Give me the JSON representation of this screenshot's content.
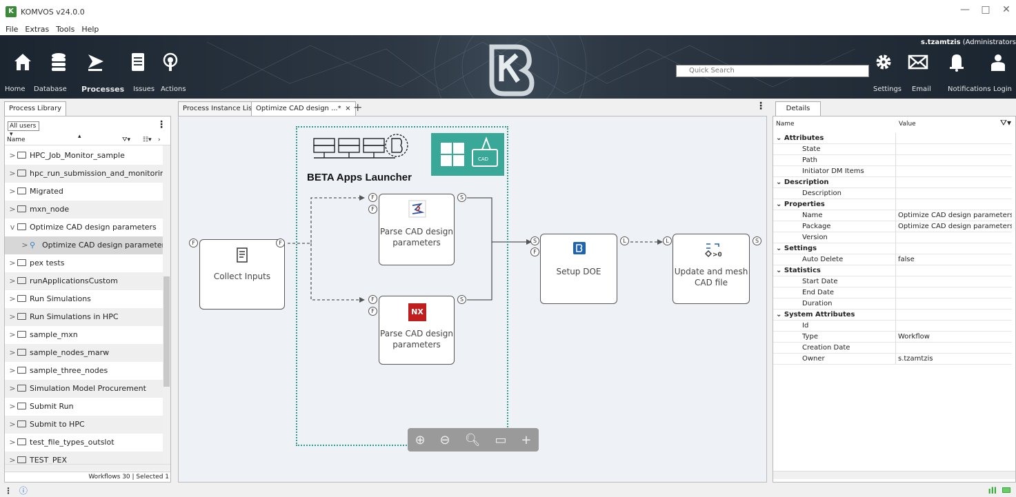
{
  "window": {
    "title": "KOMVOS v24.0.0",
    "minimize": "—",
    "maximize": "□",
    "close": "✕"
  },
  "menu": [
    "File",
    "Extras",
    "Tools",
    "Help"
  ],
  "toolbar": {
    "buttons": [
      {
        "label": "Home",
        "icon": "home-icon"
      },
      {
        "label": "Database",
        "icon": "database-icon"
      },
      {
        "label": "Processes",
        "icon": "processes-icon",
        "active": true
      },
      {
        "label": "Issues",
        "icon": "issues-icon"
      },
      {
        "label": "Actions",
        "icon": "actions-icon"
      }
    ],
    "right_buttons": [
      {
        "label": "Settings",
        "icon": "gear-icon"
      },
      {
        "label": "Email",
        "icon": "email-icon"
      },
      {
        "label": "Notifications",
        "icon": "bell-icon"
      },
      {
        "label": "Login",
        "icon": "user-icon"
      }
    ],
    "search_placeholder": "Quick Search",
    "user_name": "s.tzamtzis",
    "user_role": "(Administrators"
  },
  "library": {
    "tab": "Process Library",
    "filter": "All users",
    "column": "Name",
    "items": [
      {
        "label": "HPC_Job_Monitor_sample",
        "chev": ">",
        "type": "folder"
      },
      {
        "label": "hpc_run_submission_and_monitoring",
        "chev": ">",
        "type": "folder"
      },
      {
        "label": "Migrated",
        "chev": ">",
        "type": "folder"
      },
      {
        "label": "mxn_node",
        "chev": ">",
        "type": "folder"
      },
      {
        "label": "Optimize CAD design parameters",
        "chev": "v",
        "type": "folder"
      },
      {
        "label": "Optimize CAD design parameters",
        "chev": ">",
        "type": "workflow",
        "indent": true,
        "selected": true
      },
      {
        "label": "pex tests",
        "chev": ">",
        "type": "folder"
      },
      {
        "label": "runApplicationsCustom",
        "chev": ">",
        "type": "folder"
      },
      {
        "label": "Run Simulations",
        "chev": ">",
        "type": "folder"
      },
      {
        "label": "Run Simulations in HPC",
        "chev": ">",
        "type": "folder"
      },
      {
        "label": "sample_mxn",
        "chev": ">",
        "type": "folder"
      },
      {
        "label": "sample_nodes_marw",
        "chev": ">",
        "type": "folder"
      },
      {
        "label": "sample_three_nodes",
        "chev": ">",
        "type": "folder"
      },
      {
        "label": "Simulation Model Procurement",
        "chev": ">",
        "type": "folder"
      },
      {
        "label": "Submit Run",
        "chev": ">",
        "type": "folder"
      },
      {
        "label": "Submit to HPC",
        "chev": ">",
        "type": "folder"
      },
      {
        "label": "test_file_types_outslot",
        "chev": ">",
        "type": "folder"
      },
      {
        "label": "TEST_PEX",
        "chev": ">",
        "type": "folder"
      }
    ],
    "status": "Workflows 30 | Selected 1"
  },
  "editor": {
    "tabs": [
      {
        "label": "Process Instance List"
      },
      {
        "label": "Optimize CAD design ...*",
        "active": true
      }
    ],
    "close": "×",
    "add": "+",
    "group_title": "BETA Apps Launcher",
    "nodes": {
      "collect": "Collect Inputs",
      "parse1": "Parse CAD design parameters",
      "parse2": "Parse CAD design parameters",
      "doe": "Setup DOE",
      "update": "Update and mesh CAD file"
    },
    "nx_badge": "NX",
    "cad_badge": "CAD"
  },
  "details": {
    "tab": "Details",
    "col_name": "Name",
    "col_value": "Value",
    "rows": [
      {
        "name": "Attributes",
        "group": true
      },
      {
        "name": "State",
        "value": ""
      },
      {
        "name": "Path",
        "value": ""
      },
      {
        "name": "Initiator DM Items",
        "value": ""
      },
      {
        "name": "Description",
        "group": true
      },
      {
        "name": "Description",
        "value": ""
      },
      {
        "name": "Properties",
        "group": true
      },
      {
        "name": "Name",
        "value": "Optimize CAD design parameters"
      },
      {
        "name": "Package",
        "value": "Optimize CAD design parameters"
      },
      {
        "name": "Version",
        "value": ""
      },
      {
        "name": "Settings",
        "group": true
      },
      {
        "name": "Auto Delete",
        "value": "false"
      },
      {
        "name": "Statistics",
        "group": true
      },
      {
        "name": "Start Date",
        "value": ""
      },
      {
        "name": "End Date",
        "value": ""
      },
      {
        "name": "Duration",
        "value": ""
      },
      {
        "name": "System Attributes",
        "group": true
      },
      {
        "name": "Id",
        "value": ""
      },
      {
        "name": "Type",
        "value": "Workflow"
      },
      {
        "name": "Creation Date",
        "value": ""
      },
      {
        "name": "Owner",
        "value": "s.tzamtzis"
      }
    ]
  },
  "colors": {
    "accent": "#2a9a8a",
    "toolbar_bg": "#2d3844",
    "nx_red": "#c01e1e"
  }
}
